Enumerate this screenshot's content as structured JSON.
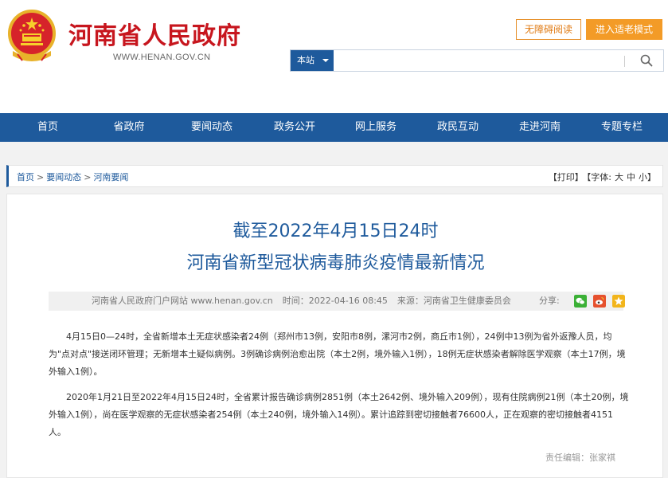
{
  "header": {
    "site_name": "河南省人民政府",
    "site_url": "WWW.HENAN.GOV.CN",
    "accessible_label": "无障碍阅读",
    "elder_mode_label": "进入适老模式",
    "search": {
      "scope": "本站",
      "value": "",
      "placeholder": ""
    }
  },
  "nav": {
    "items": [
      "首页",
      "省政府",
      "要闻动态",
      "政务公开",
      "网上服务",
      "政民互动",
      "走进河南",
      "专题专栏"
    ]
  },
  "breadcrumb": {
    "items": [
      "首页",
      "要闻动态",
      "河南要闻"
    ],
    "separator": ">"
  },
  "tools": {
    "print": "【打印】",
    "font_label": "【字体:",
    "font_large": "大",
    "font_medium": "中",
    "font_small": "小",
    "font_end": "】"
  },
  "article": {
    "title_line1": "截至2022年4月15日24时",
    "title_line2": "河南省新型冠状病毒肺炎疫情最新情况",
    "meta": {
      "source_site": "河南省人民政府门户网站 www.henan.gov.cn",
      "time": "时间：2022-04-16 08:45",
      "origin": "来源：河南省卫生健康委员会"
    },
    "share_label": "分享:",
    "share_icons": [
      {
        "name": "wechat-icon",
        "color": "#3bb036"
      },
      {
        "name": "weibo-icon",
        "color": "#e6512e"
      },
      {
        "name": "qzone-icon",
        "color": "#f2b51c"
      }
    ],
    "paragraphs": [
      "4月15日0—24时，全省新增本土无症状感染者24例（郑州市13例，安阳市8例，漯河市2例，商丘市1例），24例中13例为省外返豫人员，均为\"点对点\"接送闭环管理；无新增本土疑似病例。3例确诊病例治愈出院（本土2例，境外输入1例），18例无症状感染者解除医学观察（本土17例，境外输入1例）。",
      "2020年1月21日至2022年4月15日24时，全省累计报告确诊病例2851例（本土2642例、境外输入209例），现有住院病例21例（本土20例，境外输入1例），尚在医学观察的无症状感染者254例（本土240例，境外输入14例）。累计追踪到密切接触者76600人，正在观察的密切接触者4151人。"
    ],
    "editor": "责任编辑：张家祺"
  },
  "colors": {
    "brand_red": "#c7161e",
    "nav_blue": "#1e5a9c",
    "accent_orange": "#f39b27"
  }
}
